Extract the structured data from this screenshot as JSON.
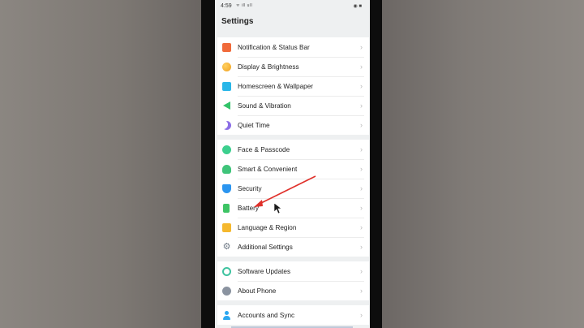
{
  "status_bar": {
    "time": "4:59",
    "signal": "ᯤ ill ull ",
    "right": "◉ ■"
  },
  "page_title": "Settings",
  "groups": [
    {
      "items": [
        {
          "label": "Notification & Status Bar",
          "icon": "notification-icon"
        },
        {
          "label": "Display & Brightness",
          "icon": "display-icon"
        },
        {
          "label": "Homescreen & Wallpaper",
          "icon": "homescreen-icon"
        },
        {
          "label": "Sound & Vibration",
          "icon": "sound-icon"
        },
        {
          "label": "Quiet Time",
          "icon": "moon-icon"
        }
      ]
    },
    {
      "items": [
        {
          "label": "Face & Passcode",
          "icon": "face-icon"
        },
        {
          "label": "Smart & Convenient",
          "icon": "smart-icon"
        },
        {
          "label": "Security",
          "icon": "shield-icon"
        },
        {
          "label": "Battery",
          "icon": "battery-icon"
        },
        {
          "label": "Language & Region",
          "icon": "language-icon"
        },
        {
          "label": "Additional Settings",
          "icon": "gear-icon"
        }
      ]
    },
    {
      "items": [
        {
          "label": "Software Updates",
          "icon": "update-icon"
        },
        {
          "label": "About Phone",
          "icon": "info-icon"
        }
      ]
    },
    {
      "items": [
        {
          "label": "Accounts and Sync",
          "icon": "person-icon"
        }
      ]
    }
  ],
  "chevron": "›",
  "colors": {
    "annotation_arrow": "#e0312b",
    "page_background": "#eef0f1",
    "row_background": "#ffffff"
  }
}
